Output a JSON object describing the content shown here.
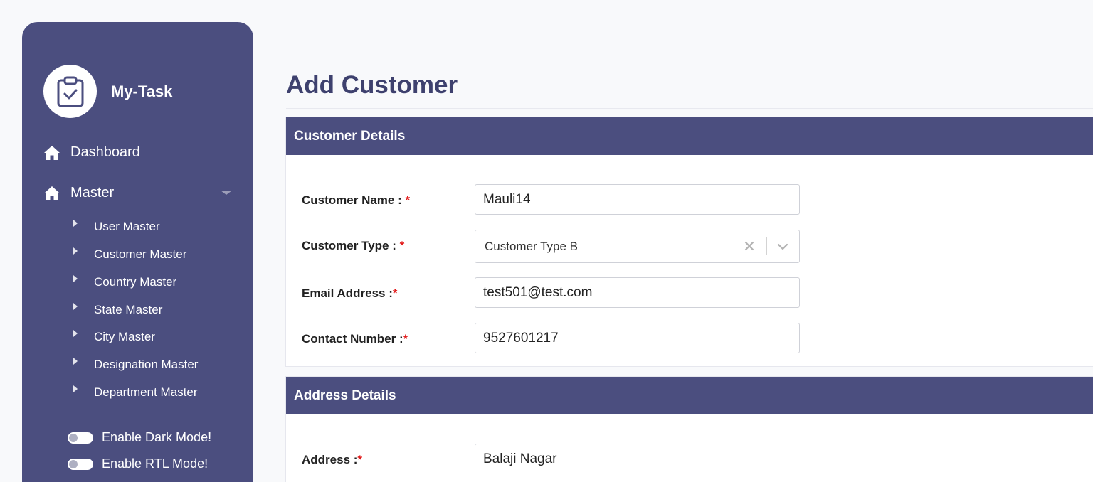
{
  "brand": {
    "name": "My-Task",
    "logo_icon": "clipboard-check-icon"
  },
  "sidebar": {
    "nav": [
      {
        "label": "Dashboard",
        "icon": "home-icon"
      },
      {
        "label": "Master",
        "icon": "home-icon"
      }
    ],
    "master_items": [
      {
        "label": "User Master"
      },
      {
        "label": "Customer Master"
      },
      {
        "label": "Country Master"
      },
      {
        "label": "State Master"
      },
      {
        "label": "City Master"
      },
      {
        "label": "Designation Master"
      },
      {
        "label": "Department Master"
      }
    ],
    "toggles": [
      {
        "label": "Enable Dark Mode!",
        "checked": false
      },
      {
        "label": "Enable RTL Mode!",
        "checked": false
      }
    ]
  },
  "page": {
    "title": "Add Customer"
  },
  "customer_details": {
    "header": "Customer Details",
    "name": {
      "label": "Customer Name : ",
      "required": "*",
      "value": "Mauli14"
    },
    "type": {
      "label": "Customer Type : ",
      "required": "*",
      "value": "Customer Type B"
    },
    "email": {
      "label": "Email Address :",
      "required": "*",
      "value": "test501@test.com"
    },
    "contact": {
      "label": "Contact Number :",
      "required": "*",
      "value": "9527601217"
    }
  },
  "address_details": {
    "header": "Address Details",
    "address": {
      "label": "Address :",
      "required": "*",
      "value": "Balaji Nagar"
    }
  },
  "colors": {
    "sidebar": "#4b4e7f",
    "title": "#3e416e",
    "required": "#e21b1b",
    "page_bg": "#f8f9fb"
  }
}
